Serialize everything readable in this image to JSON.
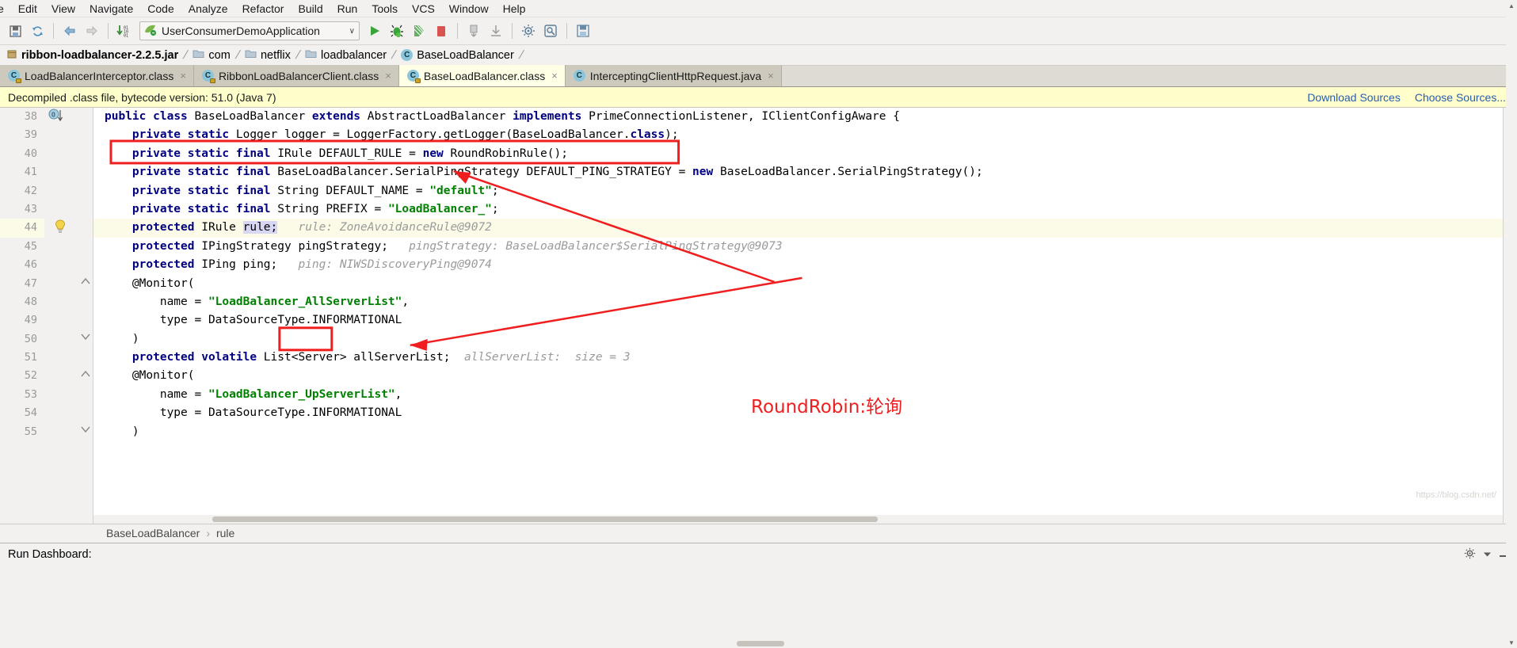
{
  "menubar": {
    "items": [
      {
        "label": "File",
        "truncated": "e"
      },
      {
        "label": "Edit"
      },
      {
        "label": "View"
      },
      {
        "label": "Navigate"
      },
      {
        "label": "Code"
      },
      {
        "label": "Analyze"
      },
      {
        "label": "Refactor"
      },
      {
        "label": "Build"
      },
      {
        "label": "Run"
      },
      {
        "label": "Tools"
      },
      {
        "label": "VCS"
      },
      {
        "label": "Window"
      },
      {
        "label": "Help"
      }
    ]
  },
  "toolbar": {
    "icons": [
      "save-all-icon",
      "sync-refresh-icon",
      "back-arrow-icon",
      "forward-arrow-icon",
      "update-project-icon"
    ],
    "run_config": {
      "name": "UserConsumerDemoApplication",
      "icon": "spring-boot-icon",
      "chevron": "∨"
    },
    "right_icons": [
      "run-icon",
      "debug-icon",
      "run-coverage-icon",
      "stop-icon",
      "attach-profiler-icon",
      "download-icon",
      "settings-icon",
      "search-everywhere-icon",
      "save-icon"
    ]
  },
  "breadcrumb": {
    "items": [
      {
        "label": "ribbon-loadbalancer-2.2.5.jar",
        "icon": "jar-icon",
        "bold": true
      },
      {
        "label": "com",
        "icon": "folder-icon"
      },
      {
        "label": "netflix",
        "icon": "folder-icon"
      },
      {
        "label": "loadbalancer",
        "icon": "folder-icon"
      },
      {
        "label": "BaseLoadBalancer",
        "icon": "class-icon"
      }
    ]
  },
  "tabs": [
    {
      "label": "LoadBalancerInterceptor.class",
      "icon": "class-decompiled-icon",
      "active": false,
      "close": "×"
    },
    {
      "label": "RibbonLoadBalancerClient.class",
      "icon": "class-decompiled-icon",
      "active": false,
      "close": "×"
    },
    {
      "label": "BaseLoadBalancer.class",
      "icon": "class-decompiled-icon",
      "active": true,
      "close": "×"
    },
    {
      "label": "InterceptingClientHttpRequest.java",
      "icon": "java-file-icon",
      "active": false,
      "close": "×"
    }
  ],
  "notification": {
    "text": "Decompiled .class file, bytecode version: 51.0 (Java 7)",
    "link_download": "Download Sources",
    "link_choose": "Choose Sources..."
  },
  "editor": {
    "first_line_number": 38,
    "lines": [
      {
        "num": 38,
        "marker": "override-implements-icon",
        "fold": "",
        "tokens": [
          {
            "t": "public",
            "c": "kw"
          },
          {
            "t": " ",
            "c": "txt"
          },
          {
            "t": "class",
            "c": "kw"
          },
          {
            "t": " BaseLoadBalancer ",
            "c": "txt"
          },
          {
            "t": "extends",
            "c": "kw"
          },
          {
            "t": " AbstractLoadBalancer ",
            "c": "txt"
          },
          {
            "t": "implements",
            "c": "kw"
          },
          {
            "t": " PrimeConnectionListener, IClientConfigAware {",
            "c": "txt"
          }
        ]
      },
      {
        "num": 39,
        "marker": "",
        "fold": "",
        "tokens": [
          {
            "t": "    ",
            "c": "txt"
          },
          {
            "t": "private static",
            "c": "kw"
          },
          {
            "t": " Logger logger = LoggerFactory.getLogger(BaseLoadBalancer.",
            "c": "txt"
          },
          {
            "t": "class",
            "c": "kw"
          },
          {
            "t": ");",
            "c": "txt"
          }
        ]
      },
      {
        "num": 40,
        "marker": "",
        "fold": "",
        "tokens": [
          {
            "t": "    ",
            "c": "txt"
          },
          {
            "t": "private static final",
            "c": "kw"
          },
          {
            "t": " IRule DEFAULT_RULE = ",
            "c": "txt"
          },
          {
            "t": "new",
            "c": "kw"
          },
          {
            "t": " RoundRobinRule();",
            "c": "txt"
          }
        ]
      },
      {
        "num": 41,
        "marker": "",
        "fold": "",
        "tokens": [
          {
            "t": "    ",
            "c": "txt"
          },
          {
            "t": "private static final",
            "c": "kw"
          },
          {
            "t": " BaseLoadBalancer.SerialPingStrategy DEFAULT_PING_STRATEGY = ",
            "c": "txt"
          },
          {
            "t": "new",
            "c": "kw"
          },
          {
            "t": " BaseLoadBalancer.SerialPingStrategy();",
            "c": "txt"
          }
        ]
      },
      {
        "num": 42,
        "marker": "",
        "fold": "",
        "tokens": [
          {
            "t": "    ",
            "c": "txt"
          },
          {
            "t": "private static final",
            "c": "kw"
          },
          {
            "t": " String DEFAULT_NAME = ",
            "c": "txt"
          },
          {
            "t": "\"default\"",
            "c": "str"
          },
          {
            "t": ";",
            "c": "txt"
          }
        ]
      },
      {
        "num": 43,
        "marker": "",
        "fold": "",
        "tokens": [
          {
            "t": "    ",
            "c": "txt"
          },
          {
            "t": "private static final",
            "c": "kw"
          },
          {
            "t": " String PREFIX = ",
            "c": "txt"
          },
          {
            "t": "\"LoadBalancer_\"",
            "c": "str"
          },
          {
            "t": ";",
            "c": "txt"
          }
        ]
      },
      {
        "num": 44,
        "marker": "intention-bulb-icon",
        "fold": "",
        "highlight": true,
        "tokens": [
          {
            "t": "    ",
            "c": "txt"
          },
          {
            "t": "protected",
            "c": "kw"
          },
          {
            "t": " IRule ",
            "c": "txt"
          },
          {
            "t": "rule;",
            "c": "sel"
          },
          {
            "t": "   ",
            "c": "txt"
          },
          {
            "t": "rule: ZoneAvoidanceRule@9072",
            "c": "hint"
          }
        ]
      },
      {
        "num": 45,
        "marker": "",
        "fold": "",
        "tokens": [
          {
            "t": "    ",
            "c": "txt"
          },
          {
            "t": "protected",
            "c": "kw"
          },
          {
            "t": " IPingStrategy pingStrategy;",
            "c": "txt"
          },
          {
            "t": "   ",
            "c": "txt"
          },
          {
            "t": "pingStrategy: BaseLoadBalancer$SerialPingStrategy@9073",
            "c": "hint"
          }
        ]
      },
      {
        "num": 46,
        "marker": "",
        "fold": "",
        "tokens": [
          {
            "t": "    ",
            "c": "txt"
          },
          {
            "t": "protected",
            "c": "kw"
          },
          {
            "t": " IPing ping;",
            "c": "txt"
          },
          {
            "t": "   ",
            "c": "txt"
          },
          {
            "t": "ping: NIWSDiscoveryPing@9074",
            "c": "hint"
          }
        ]
      },
      {
        "num": 47,
        "marker": "",
        "fold": "fold-open",
        "tokens": [
          {
            "t": "    @Monitor(",
            "c": "txt"
          }
        ]
      },
      {
        "num": 48,
        "marker": "",
        "fold": "",
        "tokens": [
          {
            "t": "        name = ",
            "c": "txt"
          },
          {
            "t": "\"LoadBalancer_AllServerList\"",
            "c": "str"
          },
          {
            "t": ",",
            "c": "txt"
          }
        ]
      },
      {
        "num": 49,
        "marker": "",
        "fold": "",
        "tokens": [
          {
            "t": "        type = DataSourceType.INFORMATIONAL",
            "c": "txt"
          }
        ]
      },
      {
        "num": 50,
        "marker": "",
        "fold": "fold-close",
        "tokens": [
          {
            "t": "    )",
            "c": "txt"
          }
        ]
      },
      {
        "num": 51,
        "marker": "",
        "fold": "",
        "tokens": [
          {
            "t": "    ",
            "c": "txt"
          },
          {
            "t": "protected volatile",
            "c": "kw"
          },
          {
            "t": " List<Server> allServerList;",
            "c": "txt"
          },
          {
            "t": "  ",
            "c": "txt"
          },
          {
            "t": "allServerList:  size = 3",
            "c": "hint"
          }
        ]
      },
      {
        "num": 52,
        "marker": "",
        "fold": "fold-open",
        "tokens": [
          {
            "t": "    @Monitor(",
            "c": "txt"
          }
        ]
      },
      {
        "num": 53,
        "marker": "",
        "fold": "",
        "tokens": [
          {
            "t": "        name = ",
            "c": "txt"
          },
          {
            "t": "\"LoadBalancer_UpServerList\"",
            "c": "str"
          },
          {
            "t": ",",
            "c": "txt"
          }
        ]
      },
      {
        "num": 54,
        "marker": "",
        "fold": "",
        "tokens": [
          {
            "t": "        type = DataSourceType.INFORMATIONAL",
            "c": "txt"
          }
        ]
      },
      {
        "num": 55,
        "marker": "",
        "fold": "fold-close",
        "tokens": [
          {
            "t": "    )",
            "c": "txt"
          }
        ]
      }
    ]
  },
  "annotations": {
    "color": "#f01e1e",
    "label": "RoundRobin:轮询",
    "box1_target": "DEFAULT_RULE declaration line 40",
    "box2_target": "rule field on line 44"
  },
  "crumb_footer": {
    "class": "BaseLoadBalancer",
    "separator": "›",
    "member": "rule"
  },
  "run_dashboard": {
    "title": "Run Dashboard:",
    "gear_icon": "gear-icon",
    "chevron_icon": "chevron-down-icon",
    "minimize_icon": "minimize-icon"
  },
  "colors": {
    "accent_red": "#f01e1e",
    "keyword_blue": "#000080",
    "string_green": "#008000",
    "hint_gray": "#9a9a9a",
    "notif_bg": "#ffffcc",
    "tab_active_bg": "#ffffe6",
    "link_blue": "#2a5db0"
  }
}
